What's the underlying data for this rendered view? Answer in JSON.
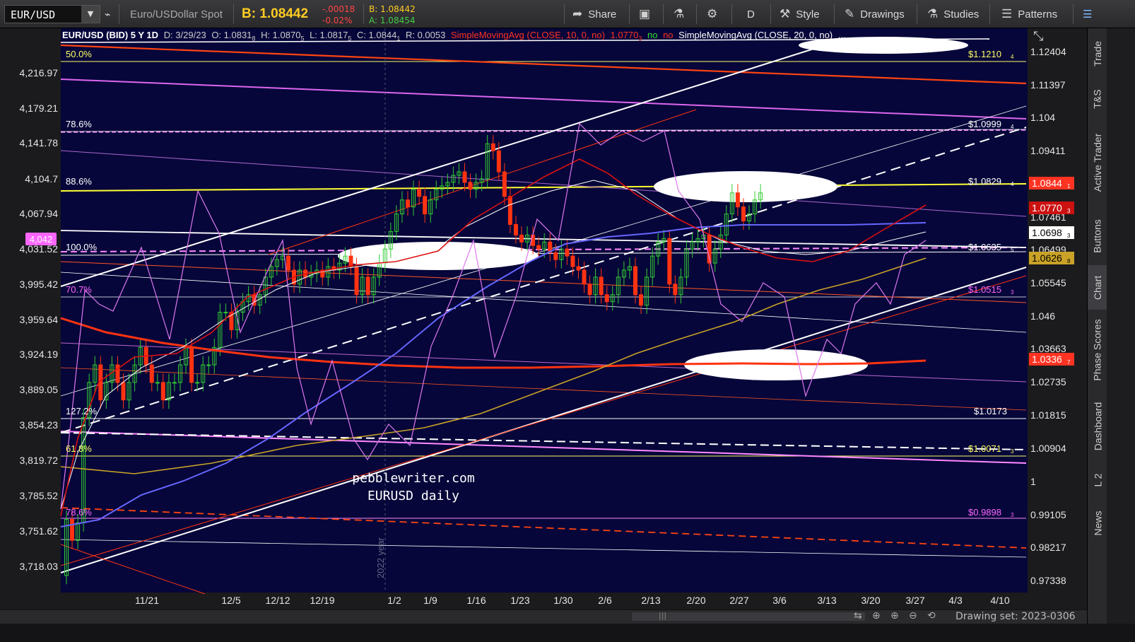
{
  "toolbar": {
    "symbol": "EUR/USD",
    "description": "Euro/USDollar Spot",
    "bid_big": "B: 1.08442",
    "change": "-.00018",
    "change_pct": "-0.02%",
    "bid_small": "B: 1.08442",
    "ask_small": "A: 1.08454",
    "share_label": "Share",
    "period_label": "D",
    "style_label": "Style",
    "drawings_label": "Drawings",
    "studies_label": "Studies",
    "patterns_label": "Patterns"
  },
  "header": {
    "title": "EUR/USD (BID) 5 Y 1D",
    "date": "D: 3/29/23",
    "open": "O: 1.0831",
    "open_sub": "8",
    "high": "H: 1.0870",
    "high_sub": "5",
    "low": "L: 1.0817",
    "low_sub": "5",
    "close": "C: 1.0844",
    "close_sub": "1",
    "range": "R: 0.0053",
    "sma10": "SimpleMovingAvg (CLOSE, 10, 0, no)",
    "sma10_val": "1.0770",
    "sma10_sub": "3",
    "no1": "no",
    "no2": "no",
    "sma20": "SimpleMovingAvg (CLOSE, 20, 0, no)",
    "ellipsis": "..."
  },
  "fib_labels": [
    {
      "pct": "50.0%",
      "price": "$1.1210",
      "sub": "4",
      "color": "#ffff66"
    },
    {
      "pct": "78.6%",
      "price": "$1.0999",
      "sub": "4",
      "color": "#ffffff"
    },
    {
      "pct": "88.6%",
      "price": "$1.0829",
      "sub": "4",
      "color": "#ffffff"
    },
    {
      "pct": "100.0%",
      "price": "$1.0635",
      "sub": "5",
      "color": "#ffffff"
    },
    {
      "pct": "70.7%",
      "price": "$1.0515",
      "sub": "3",
      "color": "#ff66ff"
    },
    {
      "pct": "127.2%",
      "price": "$1.0173",
      "sub": "",
      "color": "#ffffff"
    },
    {
      "pct": "61.8%",
      "price": "$1.0071",
      "sub": "3",
      "color": "#ffff66"
    },
    {
      "pct": "78.6%",
      "price": "$0.9898",
      "sub": "3",
      "color": "#ff66ff"
    }
  ],
  "left_axis": [
    "4,216.97",
    "4,179.21",
    "4,141.78",
    "4,104.7",
    "4,067.94",
    "4,031.52",
    "3,995.42",
    "3,959.64",
    "3,924.19",
    "3,889.05",
    "3,854.23",
    "3,819.72",
    "3,785.52",
    "3,751.62",
    "3,718.03"
  ],
  "left_badge": "4,042",
  "right_axis": [
    "1.12404",
    "1.11397",
    "1.104",
    "1.09411",
    "1.07461",
    "1.06499",
    "1.05545",
    "1.046",
    "1.03663",
    "1.02735",
    "1.01815",
    "1.00904",
    "1",
    "0.99105",
    "0.98217",
    "0.97338"
  ],
  "right_badges": [
    {
      "value": "1.0844",
      "sub": "1",
      "bg": "#ff3322",
      "fg": "#ffffff"
    },
    {
      "value": "1.0770",
      "sub": "3",
      "bg": "#cc1111",
      "fg": "#ffffff"
    },
    {
      "value": "1.0698",
      "sub": "3",
      "bg": "#ffffff",
      "fg": "#000000"
    },
    {
      "value": "1.0626",
      "sub": "8",
      "bg": "#c9a227",
      "fg": "#000000"
    },
    {
      "value": "1.0336",
      "sub": "7",
      "bg": "#ff3322",
      "fg": "#ffffff"
    }
  ],
  "x_axis": [
    "11/21",
    "12/5",
    "12/12",
    "12/19",
    "1/2",
    "1/9",
    "1/16",
    "1/23",
    "1/30",
    "2/6",
    "2/13",
    "2/20",
    "2/27",
    "3/6",
    "3/13",
    "3/20",
    "3/27",
    "4/3",
    "4/10"
  ],
  "year_marker": "2022 year",
  "watermark_1": "pebblewriter.com",
  "watermark_2": "EURUSD daily",
  "side_tabs": [
    "Trade",
    "T&S",
    "Active Trader",
    "Buttons",
    "Chart",
    "Phase Scores",
    "Dashboard",
    "L 2",
    "News"
  ],
  "drawing_set": "Drawing set: 2023-0306",
  "colors": {
    "chart_bg": "#06063a",
    "candle_up": "#33cc33",
    "candle_down": "#ff3311",
    "sma10": "#dd1111",
    "sma20": "#ffffff",
    "sma50": "#6666ff",
    "sma100": "#c9a227",
    "sma200": "#ff3311",
    "spx": "#dd77ee"
  }
}
